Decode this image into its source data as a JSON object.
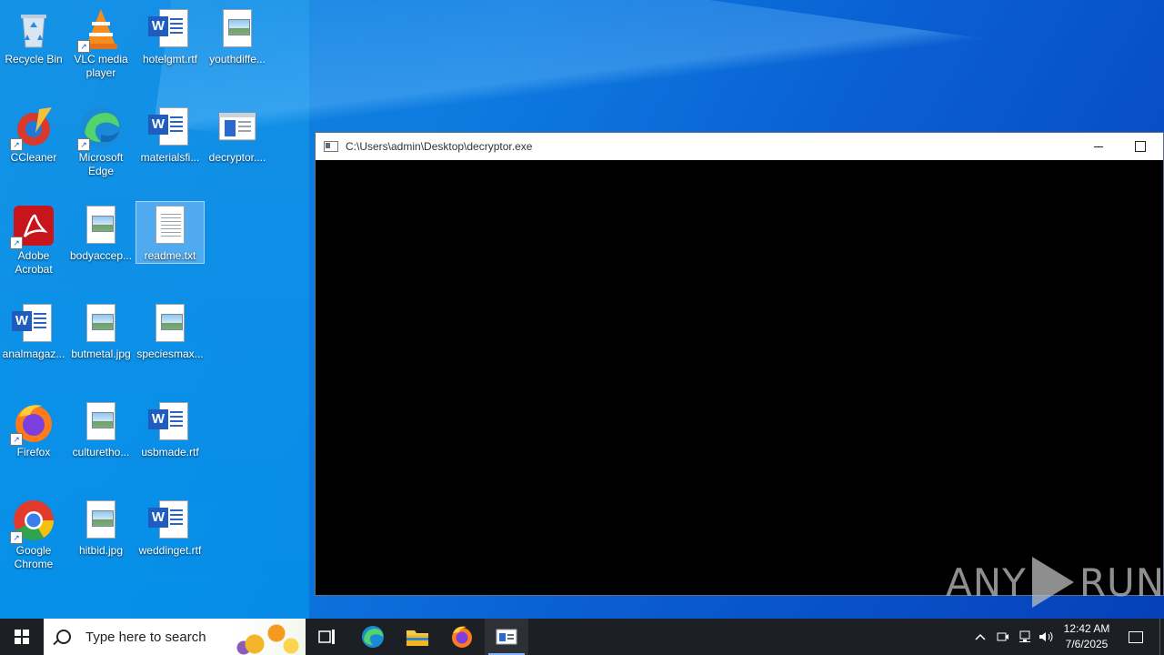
{
  "desktop": {
    "icons": [
      {
        "label": "Recycle Bin",
        "icon": "recycle-bin-icon"
      },
      {
        "label": "VLC media player",
        "icon": "vlc-icon"
      },
      {
        "label": "hotelgmt.rtf",
        "icon": "word-doc-icon"
      },
      {
        "label": "youthdiffe...",
        "icon": "image-file-icon"
      },
      {
        "label": "CCleaner",
        "icon": "ccleaner-icon"
      },
      {
        "label": "Microsoft Edge",
        "icon": "edge-icon"
      },
      {
        "label": "materialsfi...",
        "icon": "word-doc-icon"
      },
      {
        "label": "decryptor....",
        "icon": "exe-window-icon"
      },
      {
        "label": "Adobe Acrobat",
        "icon": "acrobat-icon"
      },
      {
        "label": "bodyaccep...",
        "icon": "image-file-icon"
      },
      {
        "label": "readme.txt",
        "icon": "text-file-icon"
      },
      {
        "label": "analmagaz...",
        "icon": "word-doc-icon"
      },
      {
        "label": "butmetal.jpg",
        "icon": "image-file-icon"
      },
      {
        "label": "speciesmax...",
        "icon": "image-file-icon"
      },
      {
        "label": "Firefox",
        "icon": "firefox-icon"
      },
      {
        "label": "culturetho...",
        "icon": "image-file-icon"
      },
      {
        "label": "usbmade.rtf",
        "icon": "word-doc-icon"
      },
      {
        "label": "Google Chrome",
        "icon": "chrome-icon"
      },
      {
        "label": "hitbid.jpg",
        "icon": "image-file-icon"
      },
      {
        "label": "weddinget.rtf",
        "icon": "word-doc-icon"
      }
    ]
  },
  "console": {
    "title": "C:\\Users\\admin\\Desktop\\decryptor.exe",
    "minimize": "minimize-icon",
    "maximize": "maximize-icon"
  },
  "watermark": {
    "left": "ANY",
    "right": "RUN"
  },
  "taskbar": {
    "search_placeholder": "Type here to search",
    "time": "12:42 AM",
    "date": "7/6/2025"
  },
  "colors": {
    "taskbar": "#1c2024",
    "console_bg": "#000000",
    "accent": "#0a6fd8"
  }
}
